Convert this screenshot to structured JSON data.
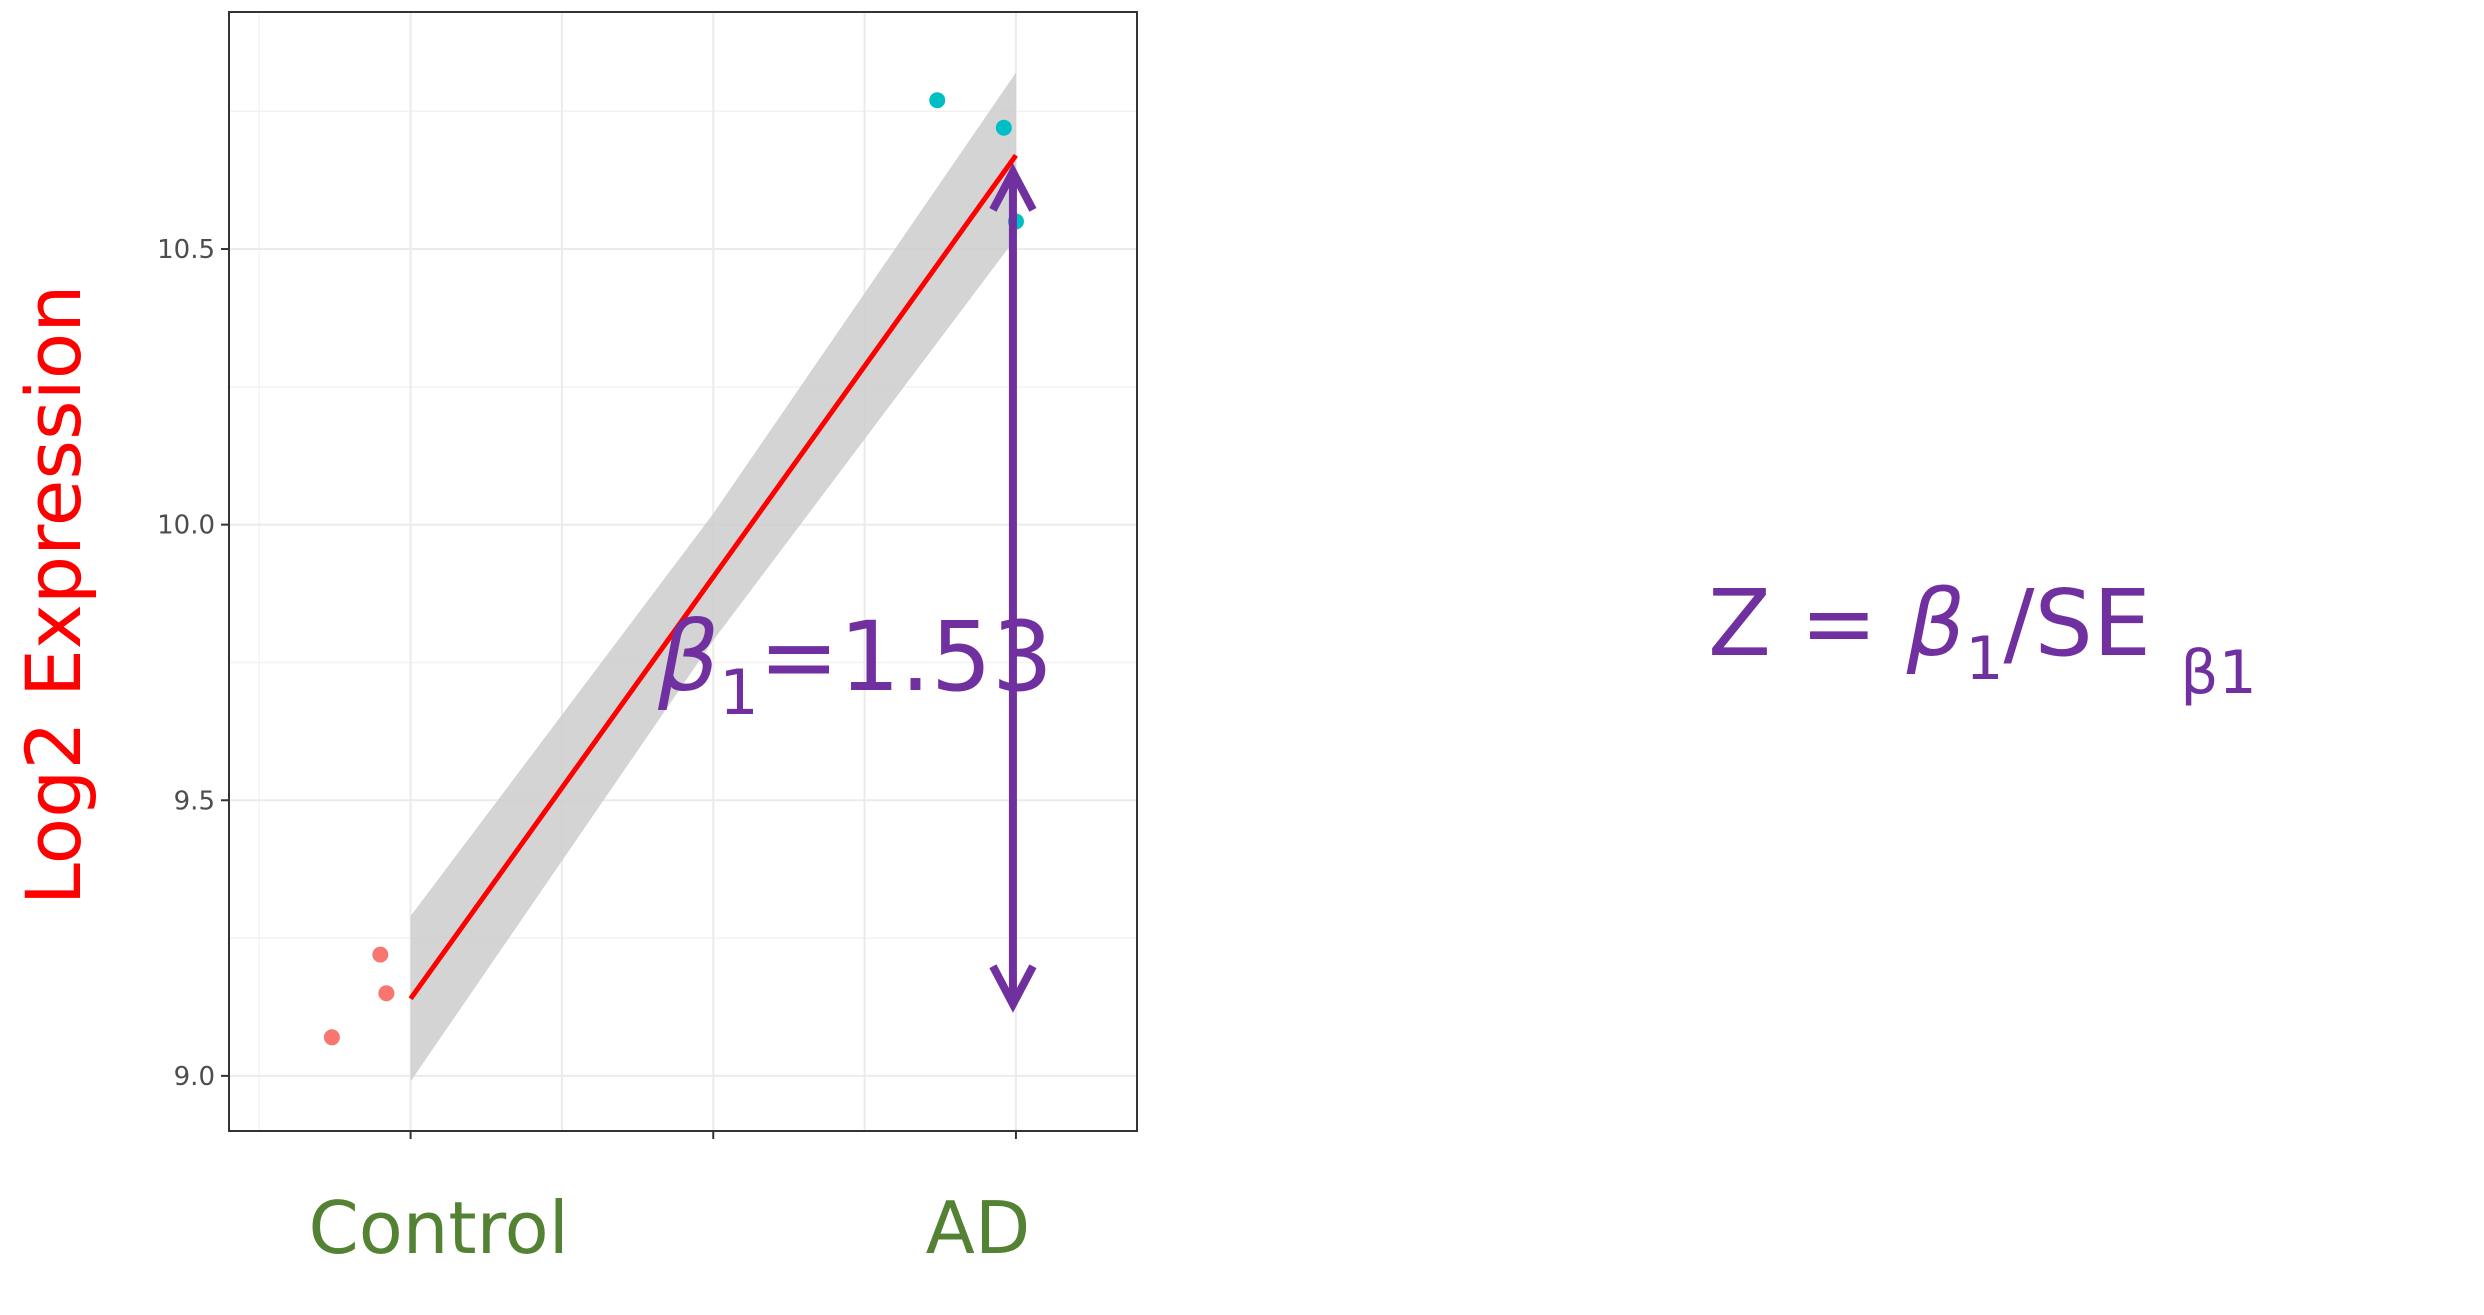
{
  "chart_data": {
    "type": "scatter",
    "xlabel": "",
    "ylabel": "Log2 Expression",
    "categories": [
      "Control",
      "AD"
    ],
    "ylim": [
      8.9,
      10.93
    ],
    "yticks": [
      9.0,
      9.5,
      10.0,
      10.5
    ],
    "ytick_labels": [
      "9.0",
      "9.5",
      "10.0",
      "10.5"
    ],
    "grid": true,
    "series": [
      {
        "category": "Control",
        "color": "#F8766D",
        "points": [
          [
            -0.13,
            9.07
          ],
          [
            -0.05,
            9.22
          ],
          [
            -0.04,
            9.15
          ]
        ]
      },
      {
        "category": "AD",
        "color": "#00BFC4",
        "points": [
          [
            0.87,
            10.77
          ],
          [
            0.98,
            10.72
          ],
          [
            1.0,
            10.55
          ]
        ]
      }
    ],
    "fit": {
      "color": "#ff0000",
      "x": [
        0.0,
        1.0
      ],
      "y": [
        9.14,
        10.67
      ],
      "band_color": "#cccccc",
      "band_lower": [
        8.99,
        10.52
      ],
      "band_upper": [
        9.29,
        10.82
      ]
    },
    "annotations": {
      "color": "#7030a0",
      "beta_symbol": "β",
      "beta_subscript": "1",
      "beta_value": "=1.53",
      "arrow_from": 9.13,
      "arrow_to": 10.64,
      "formula_left": "Z = ",
      "formula_beta": "β",
      "formula_beta_sub": "1",
      "formula_mid": "/SE ",
      "formula_sub": "β1"
    },
    "colors": {
      "ylabel": "#ff0000",
      "category_labels": "#548235"
    }
  }
}
